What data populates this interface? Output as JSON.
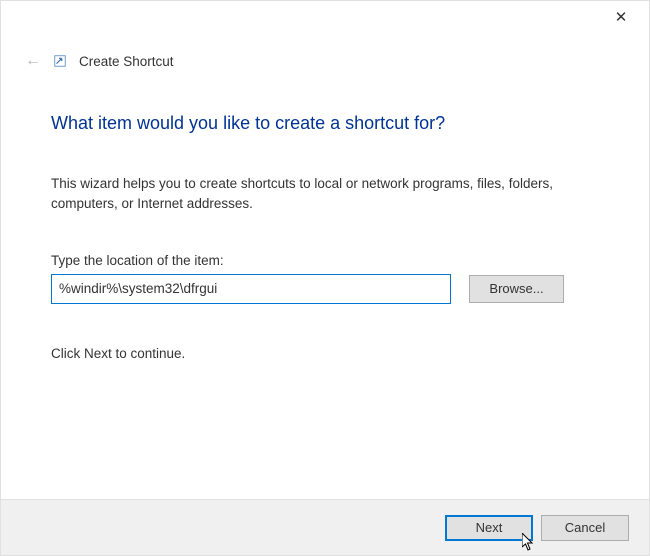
{
  "titlebar": {
    "close_symbol": "✕"
  },
  "header": {
    "back_arrow": "←",
    "wizard_name": "Create Shortcut"
  },
  "main": {
    "heading": "What item would you like to create a shortcut for?",
    "description": "This wizard helps you to create shortcuts to local or network programs, files, folders, computers, or Internet addresses.",
    "field_label": "Type the location of the item:",
    "location_value": "%windir%\\system32\\dfrgui",
    "browse_label": "Browse...",
    "continue_text": "Click Next to continue."
  },
  "footer": {
    "next_label": "Next",
    "cancel_label": "Cancel"
  }
}
